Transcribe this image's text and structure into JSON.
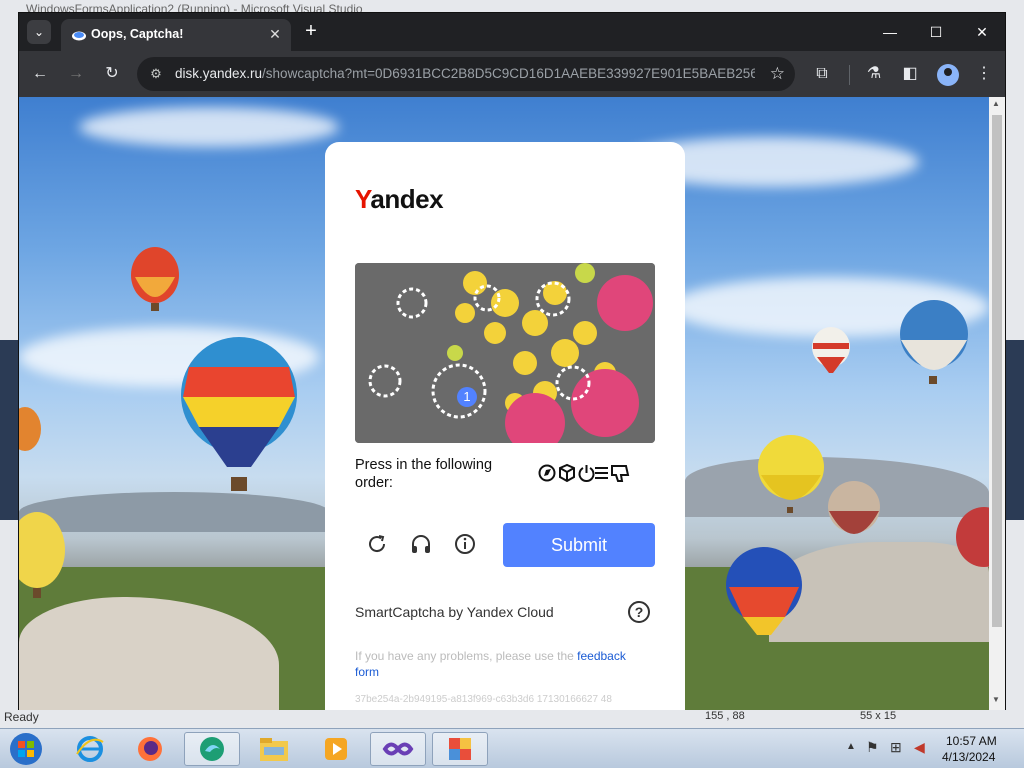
{
  "background_window": {
    "title": "WindowsFormsApplication2 (Running) - Microsoft Visual Studio",
    "status_left": "Ready",
    "status_mid": "155 , 88",
    "status_right": "55 x 15"
  },
  "browser": {
    "tab_title": "Oops, Captcha!",
    "url_host": "disk.yandex.ru",
    "url_path": "/showcaptcha?mt=0D6931BCC2B8D5C9CD16D1AAEBE339927E901E5BAEB256...",
    "window_controls": [
      "minimize-icon",
      "maximize-icon",
      "close-icon"
    ]
  },
  "captcha": {
    "logo_y": "Y",
    "logo_rest": "andex",
    "instruction": "Press in the following order:",
    "order_icons": [
      "compass-icon",
      "cube-icon",
      "power-icon",
      "menu-icon",
      "thumbs-down-icon"
    ],
    "click_marker": "1",
    "submit_label": "Submit",
    "branding": "SmartCaptcha by Yandex Cloud",
    "help_label": "?",
    "problem_text": "If you have any problems, please use the ",
    "feedback_link": "feedback form",
    "token": "37be254a-2b949195-a813f969-c63b3d6 17130166627 48"
  },
  "taskbar": {
    "time": "10:57 AM",
    "date": "4/13/2024",
    "apps": [
      "internet-explorer-icon",
      "firefox-icon",
      "edge-icon",
      "file-explorer-icon",
      "media-player-icon",
      "visual-studio-icon",
      "windows-forms-icon"
    ]
  }
}
